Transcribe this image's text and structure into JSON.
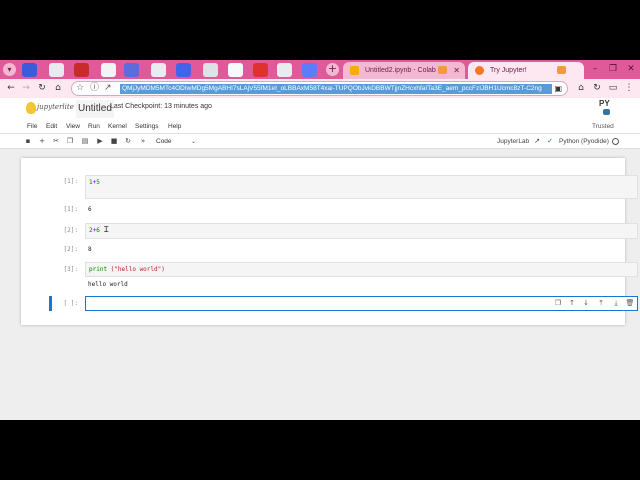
{
  "browser": {
    "tabs": [
      {
        "title": "Untitled2.ipynb - Colab",
        "active": false
      },
      {
        "title": "Try Jupyter!",
        "active": true
      }
    ],
    "url": "QMjJyMDM5MTc4ODIwMDg5MgABHI7sLAjV55fM1eI_oLBBAxM58T4xai-TUPQObJvkDBBWTjjnZHcxhfaITa3E_aem_pccFzIJBH1Ucmc8zT-C2ng",
    "window": {
      "minimize": "–",
      "restore": "❐",
      "close": "✕"
    }
  },
  "header": {
    "logo_text": "jupyterlite",
    "notebook_title": "Untitled",
    "checkpoint": "Last Checkpoint: 13 minutes ago"
  },
  "menubar": {
    "items": [
      "File",
      "Edit",
      "View",
      "Run",
      "Kernel",
      "Settings",
      "Help"
    ],
    "trusted": "Trusted"
  },
  "nbtoolbar": {
    "cell_type": "Code",
    "jupyterlab": "JupyterLab",
    "kernel": "Python (Pyodide)"
  },
  "cells": [
    {
      "prompt": "[1]:",
      "out_prompt": "[1]:",
      "code": "1+5",
      "output": "6"
    },
    {
      "prompt": "[2]:",
      "out_prompt": "[2]:",
      "code": "2+6",
      "output": "8"
    },
    {
      "prompt": "[3]:",
      "code_fn": "print",
      "code_args": " (\"hello world\")",
      "output": "hello world"
    },
    {
      "prompt": "[ ]:"
    }
  ],
  "colors": {
    "tabstrip": "#e05a99",
    "active_cell": "#1976d2",
    "url_highlight": "#5b9bd5"
  }
}
